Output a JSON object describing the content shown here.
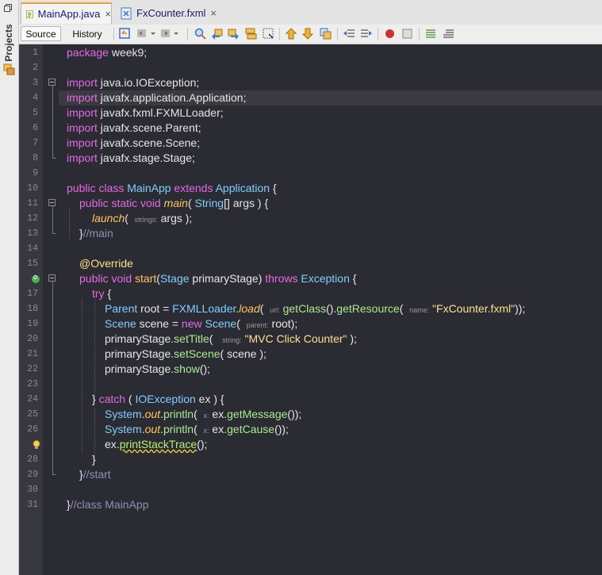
{
  "sidebar": {
    "label": "Projects"
  },
  "tabs": [
    {
      "label": "MainApp.java",
      "close": "×"
    },
    {
      "label": "FxCounter.fxml",
      "close": "×"
    }
  ],
  "toolbar": {
    "source_label": "Source",
    "history_label": "History"
  },
  "line_numbers": [
    "1",
    "2",
    "3",
    "4",
    "5",
    "6",
    "7",
    "8",
    "9",
    "10",
    "11",
    "12",
    "13",
    "14",
    "15",
    "",
    "17",
    "18",
    "19",
    "20",
    "21",
    "22",
    "23",
    "24",
    "25",
    "26",
    "",
    "28",
    "29",
    "30",
    "31"
  ],
  "code": {
    "l1": [
      "package",
      " week9;"
    ],
    "l3": [
      "import",
      " java.io.IOException;"
    ],
    "l4": [
      "import",
      " javafx.application.Application;"
    ],
    "l5": [
      "import",
      " javafx.fxml.FXMLLoader;"
    ],
    "l6": [
      "import",
      " javafx.scene.Parent;"
    ],
    "l7": [
      "import",
      " javafx.scene.Scene;"
    ],
    "l8": [
      "import",
      " javafx.stage.Stage;"
    ],
    "l10": [
      "public class",
      " MainApp ",
      "extends",
      " Application",
      " {"
    ],
    "l11": [
      "public static void",
      " main",
      "( ",
      "String",
      "[] args ) {"
    ],
    "l12": [
      "launch",
      "(  ",
      "strings:",
      " args );"
    ],
    "l13": [
      "}",
      "//main"
    ],
    "l15": [
      "@",
      "Override"
    ],
    "l16": [
      "public void",
      " start",
      "(",
      "Stage",
      " primaryStage) ",
      "throws",
      " Exception",
      " {"
    ],
    "l17": [
      "try",
      " {"
    ],
    "l18": [
      "Parent",
      " root = ",
      "FXMLLoader",
      ".",
      "load",
      "(  ",
      "url:",
      " getClass",
      "().",
      "getResource",
      "(  ",
      "name:",
      " ",
      "\"FxCounter.fxml\"",
      "));"
    ],
    "l19": [
      "Scene",
      " scene = ",
      "new",
      " Scene",
      "(  ",
      "parent:",
      " root);"
    ],
    "l20": [
      "primaryStage.",
      "setTitle",
      "(   ",
      "string:",
      " ",
      "\"MVC Click Counter\"",
      " );"
    ],
    "l21": [
      "primaryStage.",
      "setScene",
      "( scene );"
    ],
    "l22": [
      "primaryStage.",
      "show",
      "();"
    ],
    "l24": [
      "} ",
      "catch",
      " ( ",
      "IOException",
      " ex ) {"
    ],
    "l25": [
      "System",
      ".",
      "out",
      ".",
      "println",
      "(  ",
      "x:",
      " ex.",
      "getMessage",
      "());"
    ],
    "l26": [
      "System",
      ".",
      "out",
      ".",
      "println",
      "(  ",
      "x:",
      " ex.",
      "getCause",
      "());"
    ],
    "l27": [
      "ex.",
      "printStackTrace",
      "();"
    ],
    "l28": [
      "}"
    ],
    "l29": [
      "}",
      "//start"
    ],
    "l31": [
      "}",
      "//class MainApp"
    ]
  },
  "colors": {
    "keyword": "#e569e5",
    "type": "#7ecfff",
    "method": "#ffc85f",
    "string": "#ffe08a",
    "comment": "#8f8fb5",
    "background": "#2b2b33"
  }
}
